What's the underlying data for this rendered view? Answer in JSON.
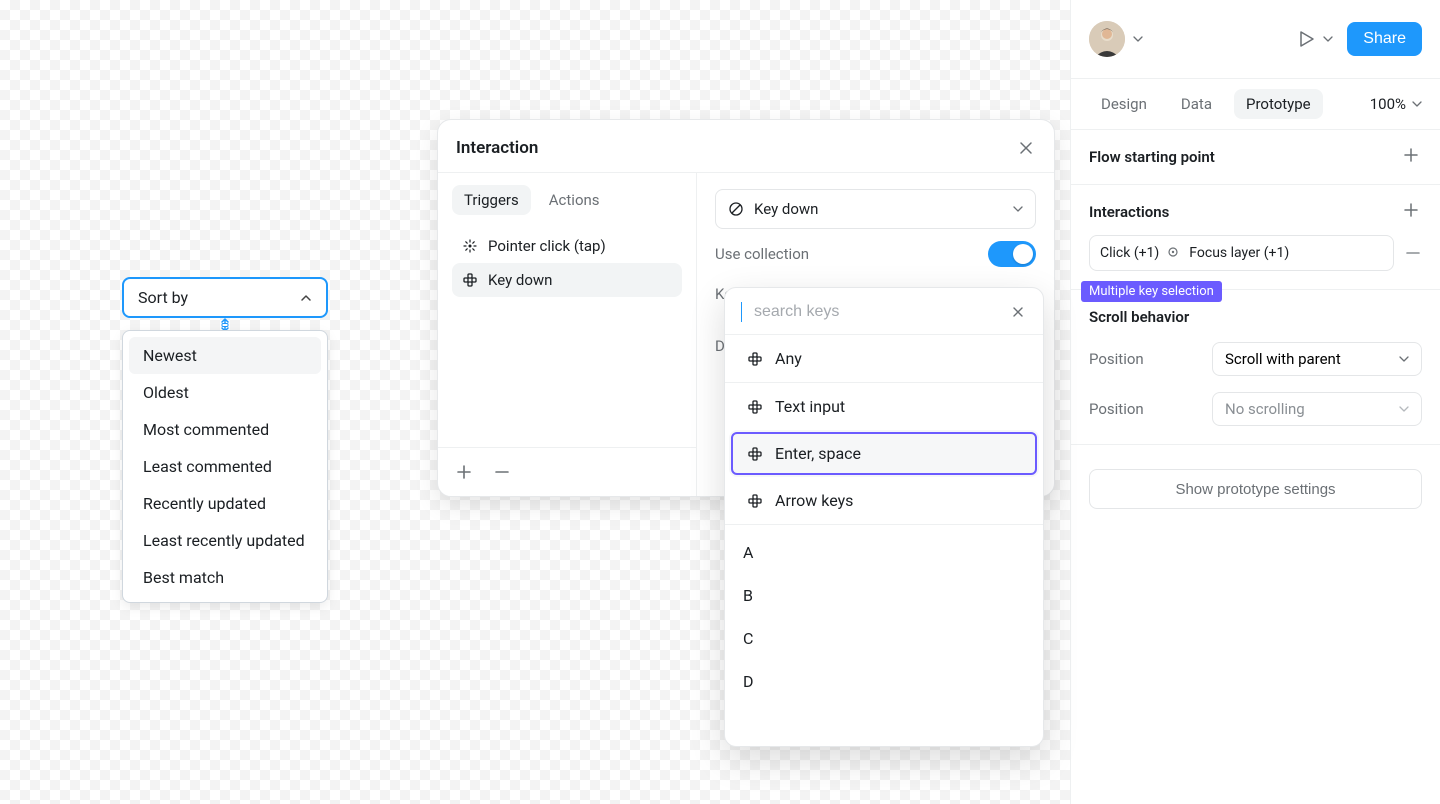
{
  "sortby": {
    "trigger_label": "Sort by",
    "options": [
      "Newest",
      "Oldest",
      "Most commented",
      "Least commented",
      "Recently updated",
      "Least recently updated",
      "Best match"
    ]
  },
  "modal": {
    "title": "Interaction",
    "tabs": {
      "triggers": "Triggers",
      "actions": "Actions"
    },
    "triggers": {
      "pointer": "Pointer click (tap)",
      "keydown": "Key down"
    },
    "select_label": "Key down",
    "tooltip": "Multiple key selection",
    "use_collection_label": "Use collection",
    "hidden_rows": {
      "ke": "Ke",
      "do": "Do"
    }
  },
  "keypicker": {
    "placeholder": "search keys",
    "groups": {
      "any": "Any",
      "text_input": "Text input",
      "enter_space": "Enter, space",
      "arrow_keys": "Arrow keys"
    },
    "letters": [
      "A",
      "B",
      "C",
      "D"
    ]
  },
  "inspector": {
    "share": "Share",
    "tabs": {
      "design": "Design",
      "data": "Data",
      "prototype": "Prototype"
    },
    "zoom": "100%",
    "flow_title": "Flow starting point",
    "interactions_title": "Interactions",
    "interaction_chip": {
      "click": "Click (+1)",
      "focus": "Focus layer (+1)"
    },
    "scroll_title": "Scroll behavior",
    "position_label": "Position",
    "scroll_select_1": "Scroll with parent",
    "scroll_select_2": "No scrolling",
    "show_proto": "Show prototype settings"
  }
}
